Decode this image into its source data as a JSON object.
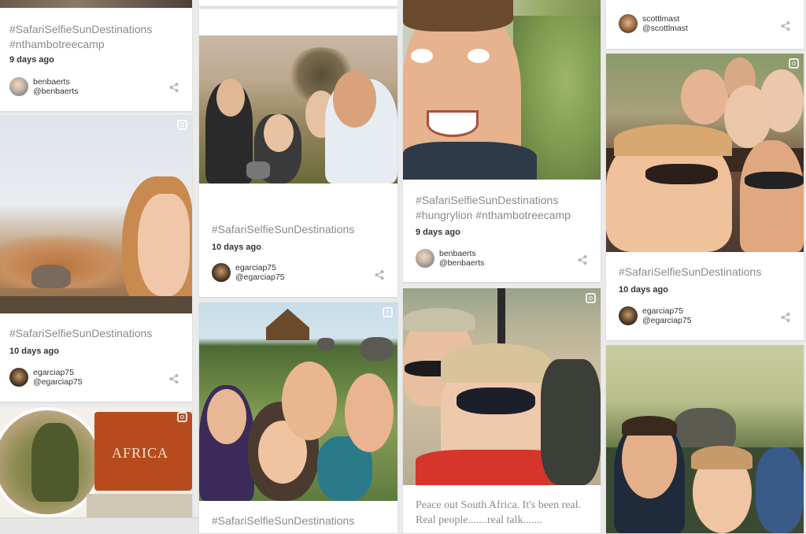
{
  "social": {
    "home_icon": "home-icon",
    "twitter_icon": "twitter-icon",
    "instagram_icon": "instagram-icon"
  },
  "posts": {
    "c1p1": {
      "caption": "#SafariSelfieSunDestinations #nthambotreecamp",
      "date": "9 days ago",
      "name": "benbaerts",
      "handle": "@benbaerts"
    },
    "c1p2": {
      "caption": "#SafariSelfieSunDestinations",
      "date": "10 days ago",
      "name": "egarciap75",
      "handle": "@egarciap75"
    },
    "c1p3": {
      "sign_text": "AFRICA"
    },
    "c2p1": {
      "caption": "#SafariSelfieSunDestinations",
      "date": "10 days ago",
      "name": "egarciap75",
      "handle": "@egarciap75"
    },
    "c2p2": {
      "caption": "#SafariSelfieSunDestinations"
    },
    "c3p1": {
      "caption": "#SafariSelfieSunDestinations #hungrylion #nthambotreecamp",
      "date": "9 days ago",
      "name": "benbaerts",
      "handle": "@benbaerts"
    },
    "c3p2": {
      "caption": "Peace out South Africa. It's been real. Real people.......real talk......."
    },
    "c4p1": {
      "name": "scottlmast",
      "handle": "@scottlmast"
    },
    "c4p2": {
      "caption": "#SafariSelfieSunDestinations",
      "date": "10 days ago",
      "name": "egarciap75",
      "handle": "@egarciap75"
    }
  }
}
